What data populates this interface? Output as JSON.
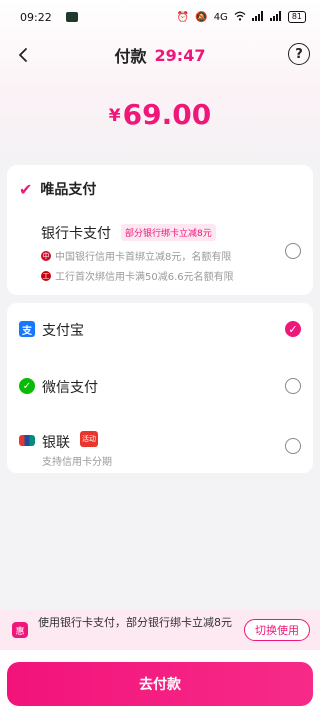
{
  "status_bar": {
    "time": "09:22",
    "network": "4G",
    "battery": "81"
  },
  "header": {
    "title": "付款",
    "countdown": "29:47",
    "help_icon": "?"
  },
  "amount": {
    "currency": "¥",
    "value": "69.00"
  },
  "vip_pay": {
    "title": "唯品支付",
    "bank_card": {
      "label": "银行卡支付",
      "promo_tag": "部分银行绑卡立减8元",
      "offers": [
        "中国银行信用卡首绑立减8元，名额有限",
        "工行首次绑信用卡满50减6.6元名额有限"
      ],
      "selected": false
    }
  },
  "methods": [
    {
      "label": "支付宝",
      "icon": "alipay-icon",
      "selected": true
    },
    {
      "label": "微信支付",
      "icon": "wechat-pay-icon",
      "selected": false
    },
    {
      "label": "银联",
      "icon": "unionpay-icon",
      "sub": "支持信用卡分期",
      "selected": false
    }
  ],
  "tip": {
    "text": "使用银行卡支付，部分银行绑卡立减8元",
    "button": "切换使用"
  },
  "footer": {
    "pay_button": "去付款"
  },
  "colors": {
    "accent": "#f0177b",
    "alipay": "#1677ff",
    "wechat": "#09bb07",
    "unionpay": "#e8352e"
  }
}
